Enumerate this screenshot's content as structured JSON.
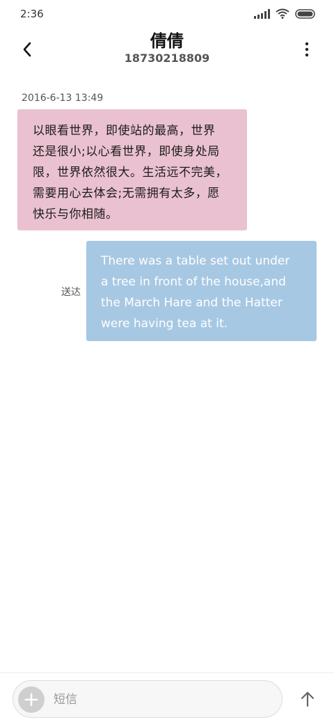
{
  "status_bar": {
    "time": "2:36",
    "icons": [
      "signal-icon",
      "wifi-icon",
      "battery-icon"
    ]
  },
  "header": {
    "contact_name": "倩倩",
    "contact_number": "18730218809",
    "back_icon": "chevron-left-icon",
    "more_icon": "more-vertical-icon"
  },
  "conversation": {
    "timestamp": "2016-6-13 13:49",
    "incoming": {
      "lines": [
        "以眼看世界，即使站的最高，世界",
        "还是很小;以心看世界，即使身处局",
        "限，世界依然很大。生活远不完美，",
        "需要用心去体会;无需拥有太多，愿",
        "快乐与你相随。"
      ],
      "color": "#eac1d0"
    },
    "outgoing": {
      "lines": [
        "There was a table set out under",
        "a tree in front of the house,and",
        "the March Hare and the Hatter",
        "were having tea at it."
      ],
      "status": "送达",
      "color": "#a7c8e3"
    }
  },
  "composer": {
    "placeholder": "短信",
    "add_icon": "plus-icon",
    "send_icon": "arrow-up-icon"
  }
}
